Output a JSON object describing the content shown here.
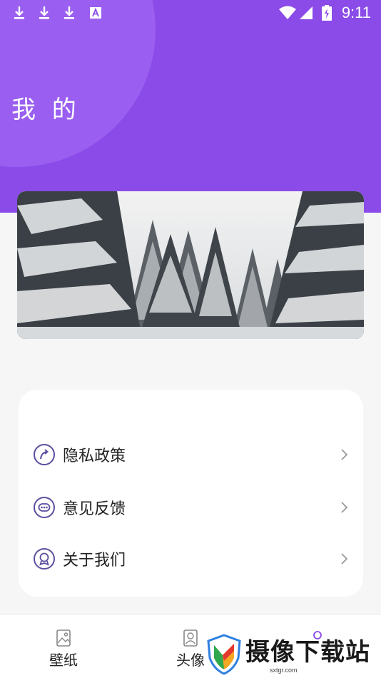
{
  "status_bar": {
    "time": "9:11",
    "left_icons": [
      "download-icon",
      "download-icon",
      "download-icon",
      "a-notification-icon"
    ],
    "right_icons": [
      "wifi-icon",
      "signal-icon",
      "battery-icon"
    ]
  },
  "header": {
    "title": "我 的",
    "background_color": "#8a4be8"
  },
  "banner": {
    "image": "snowy-pine-forest"
  },
  "menu": {
    "items": [
      {
        "label": "隐私政策",
        "icon": "privacy-policy-icon"
      },
      {
        "label": "意见反馈",
        "icon": "feedback-icon"
      },
      {
        "label": "关于我们",
        "icon": "about-us-icon"
      }
    ]
  },
  "bottom_nav": {
    "items": [
      {
        "label": "壁纸",
        "icon": "wallpaper-icon"
      },
      {
        "label": "头像",
        "icon": "avatar-icon"
      },
      {
        "label": "",
        "icon": "profile-icon"
      }
    ]
  },
  "watermark": {
    "text": "摄像下载站",
    "url": "sxtgr.com"
  }
}
